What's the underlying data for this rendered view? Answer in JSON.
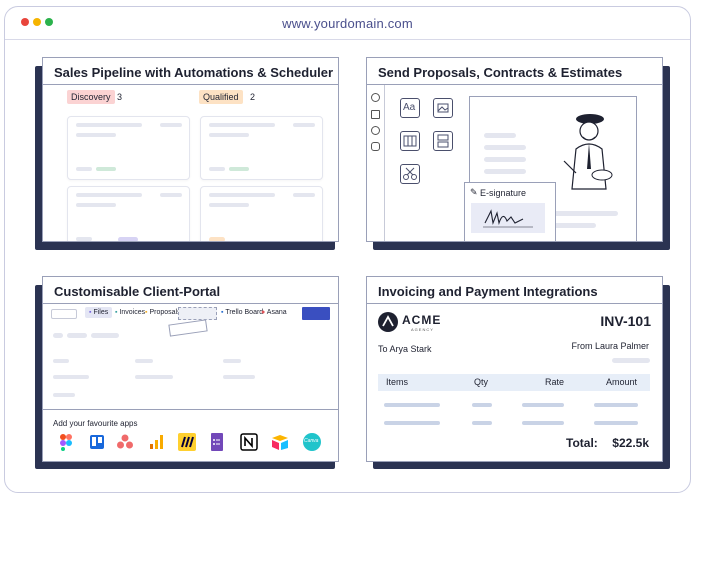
{
  "browser": {
    "url": "www.yourdomain.com",
    "dots": [
      "#e8453c",
      "#f5b400",
      "#2bb24c"
    ]
  },
  "pipeline": {
    "title": "Sales Pipeline with Automations & Scheduler",
    "columns": [
      {
        "label": "Discovery",
        "count": "3",
        "color": "#fbd3d3"
      },
      {
        "label": "Qualified",
        "count": "2",
        "color": "#fde2c4"
      }
    ]
  },
  "proposals": {
    "title": "Send Proposals, Contracts & Estimates",
    "text_tool_label": "Aa",
    "esign_label": "E-signature"
  },
  "portal": {
    "title": "Customisable Client-Portal",
    "tabs": [
      "Files",
      "Invoices",
      "Proposals",
      "Trello Board",
      "Asana"
    ],
    "apps_label": "Add your favourite apps",
    "apps": [
      "figma-icon",
      "trello-icon",
      "asana-icon",
      "analytics-icon",
      "miro-icon",
      "google-forms-icon",
      "notion-icon",
      "airtable-icon",
      "canva-icon"
    ],
    "canva_label": "Canva"
  },
  "invoicing": {
    "title": "Invoicing and Payment Integrations",
    "brand": "ACME",
    "brand_sub": "AGENCY",
    "invoice_no": "INV-101",
    "to": "To Arya Stark",
    "from": "From Laura Palmer",
    "headers": [
      "Items",
      "Qty",
      "Rate",
      "Amount"
    ],
    "total_label": "Total:",
    "total_value": "$22.5k"
  }
}
